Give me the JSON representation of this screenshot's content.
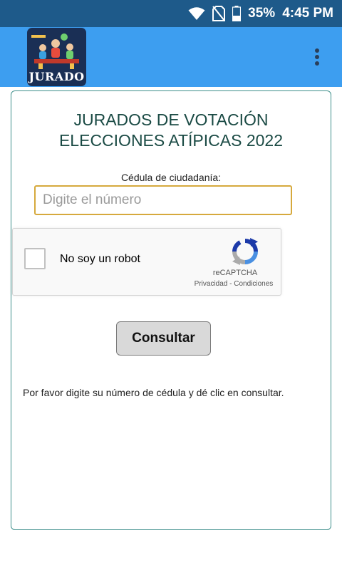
{
  "status_bar": {
    "icons": [
      "wifi-icon",
      "no-sim-icon",
      "battery-icon"
    ],
    "battery_percent": "35%",
    "time": "4:45 PM"
  },
  "app_bar": {
    "logo_text": "JURADO",
    "menu_icon": "more-vert-icon"
  },
  "form": {
    "title_line1": "JURADOS DE VOTACIÓN",
    "title_line2": "ELECCIONES ATÍPICAS 2022",
    "cedula_label": "Cédula de ciudadanía:",
    "cedula_placeholder": "Digite el número",
    "cedula_value": "",
    "recaptcha": {
      "label": "No soy un robot",
      "brand": "reCAPTCHA",
      "privacy": "Privacidad",
      "separator": " - ",
      "terms": "Condiciones",
      "checked": false
    },
    "submit_label": "Consultar",
    "help_text": "Por favor digite su número de cédula y dé clic en consultar."
  },
  "colors": {
    "status_bar": "#1e5a8a",
    "app_bar": "#3d9ef0",
    "card_border": "#3e8f8b",
    "title": "#1a4a44",
    "input_border": "#d6a93d"
  }
}
